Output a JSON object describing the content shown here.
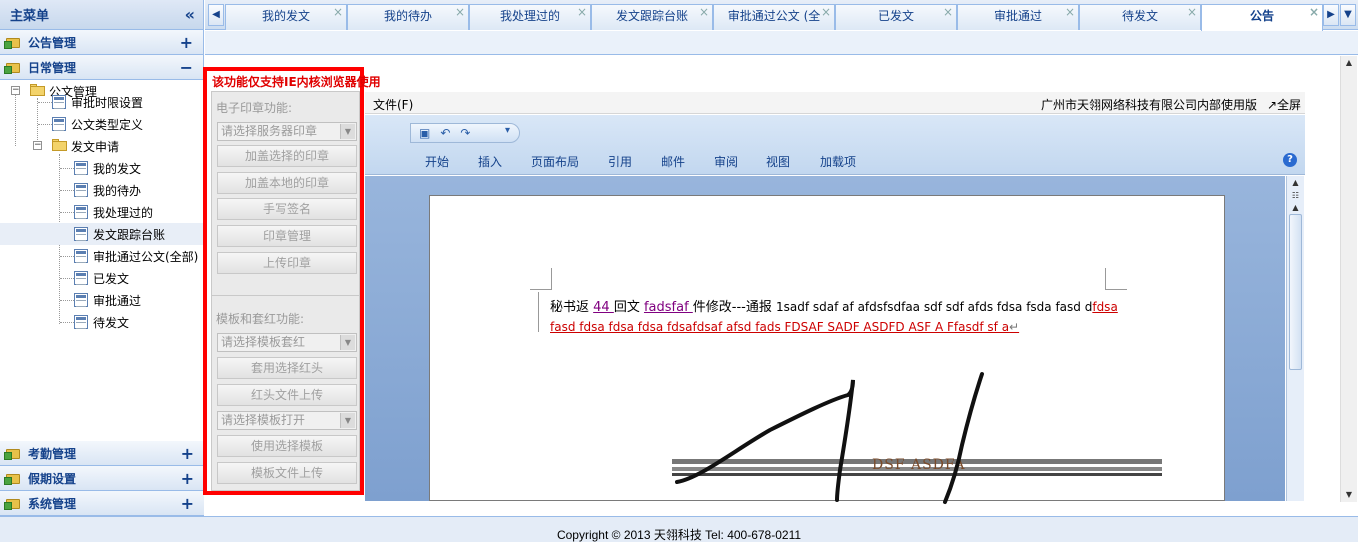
{
  "sidebar": {
    "title": "主菜单",
    "collapse_glyph": "«",
    "sections_top": [
      {
        "label": "公告管理",
        "toggle": "+"
      },
      {
        "label": "日常管理",
        "toggle": "−"
      }
    ],
    "tree": {
      "root": "公文管理",
      "items": [
        "审批时限设置",
        "公文类型定义"
      ],
      "sub_folder": "发文申请",
      "sub_items": [
        "我的发文",
        "我的待办",
        "我处理过的",
        "发文跟踪台账",
        "审批通过公文(全部)",
        "已发文",
        "审批通过",
        "待发文"
      ],
      "selected": "发文跟踪台账"
    },
    "sections_bottom": [
      {
        "label": "考勤管理",
        "toggle": "+"
      },
      {
        "label": "假期设置",
        "toggle": "+"
      },
      {
        "label": "系统管理",
        "toggle": "+"
      }
    ]
  },
  "tabs": {
    "scroll_left": "◀",
    "scroll_right": "▶",
    "menu": "▼",
    "close_glyph": "×",
    "items": [
      "我的发文",
      "我的待办",
      "我处理过的",
      "发文跟踪台账",
      "审批通过公文 (全",
      "已发文",
      "审批通过",
      "待发文",
      "公告"
    ],
    "active": "公告"
  },
  "notice": "该功能仅支持IE内核浏览器使用",
  "seal_panel": {
    "section1_label": "电子印章功能:",
    "select1": "请选择服务器印章",
    "buttons1": [
      "加盖选择的印章",
      "加盖本地的印章",
      "手写签名",
      "印章管理",
      "上传印章"
    ],
    "section2_label": "模板和套红功能:",
    "select2": "请选择模板套红",
    "buttons2": [
      "套用选择红头",
      "红头文件上传"
    ],
    "select3": "请选择模板打开",
    "buttons3": [
      "使用选择模板",
      "模板文件上传"
    ]
  },
  "word": {
    "file_menu": "文件(F)",
    "version_text": "广州市天翎网络科技有限公司内部使用版",
    "fullscreen": "↗全屏",
    "ribbon_tabs": [
      "开始",
      "插入",
      "页面布局",
      "引用",
      "邮件",
      "审阅",
      "视图",
      "加载项"
    ],
    "doc_line1": {
      "a": "秘书返 ",
      "b": "44 ",
      "c": "回文 ",
      "d": "fadsfaf ",
      "e": "件修改---通报 ",
      "f": "1sadf sdaf af afdsfsdfaa sdf sdf afds fdsa fsda fasd d",
      "g": "fdsa"
    },
    "doc_line2": "fasd fdsa fdsa fdsa fdsafdsaf afsd fads FDSAF SADF ASDFD ASF A Ffasdf sf a",
    "para_mark": "↵",
    "stamp_text": "DSF ASDFA"
  },
  "footer": "Copyright © 2013 天翎科技  Tel: 400-678-0211",
  "colors": {
    "accent": "#15428b",
    "border": "#99bbe8",
    "alert": "#ff0000"
  }
}
